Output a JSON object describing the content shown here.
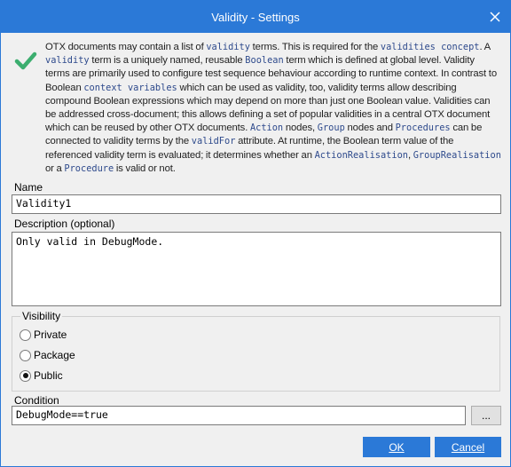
{
  "window": {
    "title": "Validity - Settings"
  },
  "info": {
    "icon": "check-icon",
    "segments": [
      {
        "t": "OTX documents may contain a list of "
      },
      {
        "t": "validity",
        "code": true
      },
      {
        "t": " terms. This is required for the "
      },
      {
        "t": "validities concept",
        "code": true
      },
      {
        "t": ". A "
      },
      {
        "t": "validity",
        "code": true
      },
      {
        "t": " term is a uniquely named, reusable "
      },
      {
        "t": "Boolean",
        "code": true
      },
      {
        "t": " term which is defined at global level. Validity terms are primarily used to configure test sequence behaviour according to runtime context. In contrast to Boolean "
      },
      {
        "t": "context variables",
        "code": true
      },
      {
        "t": " which can be used as validity, too, validity terms allow describing compound Boolean expressions which may depend on more than just one Boolean value. Validities can be addressed cross-document; this allows defining a set of popular validities in a central OTX document which can be reused by other OTX documents. "
      },
      {
        "t": "Action",
        "code": true
      },
      {
        "t": " nodes, "
      },
      {
        "t": "Group",
        "code": true
      },
      {
        "t": " nodes and "
      },
      {
        "t": "Procedures",
        "code": true
      },
      {
        "t": " can be connected to validity terms by the "
      },
      {
        "t": "validFor",
        "code": true
      },
      {
        "t": " attribute. At runtime, the Boolean term value of the referenced validity term is evaluated; it determines whether an "
      },
      {
        "t": "ActionRealisation",
        "code": true
      },
      {
        "t": ", "
      },
      {
        "t": "GroupRealisation",
        "code": true
      },
      {
        "t": " or a "
      },
      {
        "t": "Procedure",
        "code": true
      },
      {
        "t": " is valid or not."
      }
    ]
  },
  "name": {
    "label": "Name",
    "value": "Validity1"
  },
  "description": {
    "label": "Description (optional)",
    "value": "Only valid in DebugMode."
  },
  "visibility": {
    "label": "Visibility",
    "options": [
      "Private",
      "Package",
      "Public"
    ],
    "selected": "Public"
  },
  "condition": {
    "label": "Condition",
    "value": "DebugMode==true",
    "browse_label": "..."
  },
  "buttons": {
    "ok": "OK",
    "cancel": "Cancel"
  },
  "colors": {
    "accent": "#2b79d7",
    "check": "#3cae6f",
    "code": "#2e4a8c"
  }
}
